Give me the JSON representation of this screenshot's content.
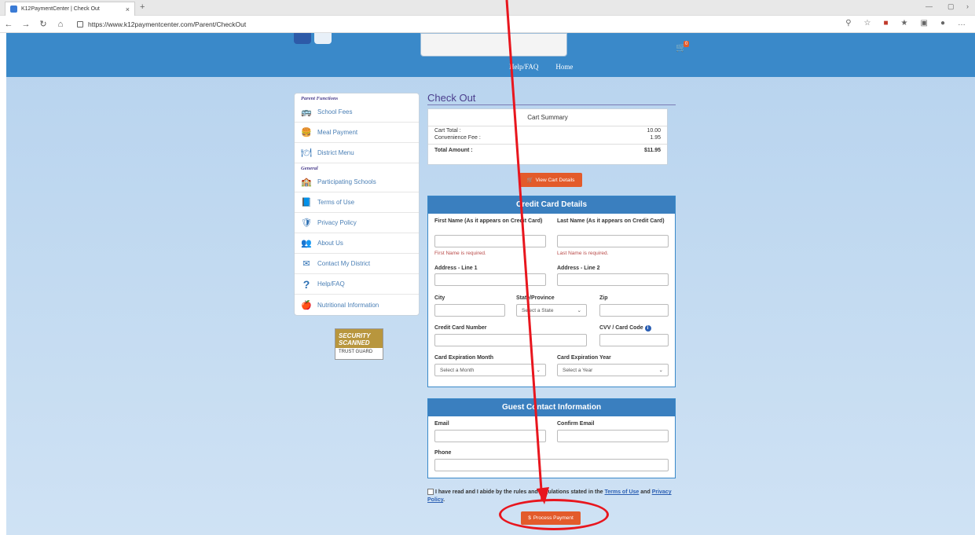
{
  "browser": {
    "tab_title": "K12PaymentCenter | Check Out",
    "tab_close": "×",
    "new_tab": "+",
    "url": "https://www.k12paymentcenter.com/Parent/CheckOut",
    "back": "←",
    "forward": "→",
    "refresh": "↻",
    "home": "⌂",
    "minimize": "—",
    "restore": "▢",
    "more": "…",
    "chevron": "›"
  },
  "header": {
    "logo_text": "",
    "cart_count": "0",
    "nav": {
      "help": "Help/FAQ",
      "home": "Home"
    }
  },
  "sidebar": {
    "sections": [
      {
        "label": "Parent Functions",
        "items": [
          {
            "label": "School Fees",
            "icon": "bus-icon"
          },
          {
            "label": "Meal Payment",
            "icon": "food-icon"
          },
          {
            "label": "District Menu",
            "icon": "plate-icon"
          }
        ]
      },
      {
        "label": "General",
        "items": [
          {
            "label": "Participating Schools",
            "icon": "school-icon"
          },
          {
            "label": "Terms of Use",
            "icon": "book-icon"
          },
          {
            "label": "Privacy Policy",
            "icon": "shield-icon"
          },
          {
            "label": "About Us",
            "icon": "people-icon"
          },
          {
            "label": "Contact My District",
            "icon": "envelope-icon"
          },
          {
            "label": "Help/FAQ",
            "icon": "question-icon"
          },
          {
            "label": "Nutritional Information",
            "icon": "apple-icon"
          }
        ]
      }
    ],
    "security_badge": {
      "title": "SECURITY SCANNED",
      "sub": "TRUST GUARD"
    }
  },
  "checkout": {
    "title": "Check Out",
    "summary": {
      "header": "Cart Summary",
      "cart_total_label": "Cart Total :",
      "cart_total_value": "10.00",
      "fee_label": "Convenience Fee :",
      "fee_value": "1.95",
      "total_label": "Total Amount :",
      "total_value": "$11.95"
    },
    "view_cart_label": "View Cart Details"
  },
  "credit_card": {
    "title": "Credit Card Details",
    "first_name_label": "First Name (As it appears on Credit Card)",
    "last_name_label": "Last Name (As it appears on Credit Card)",
    "first_name_error": "First Name is required.",
    "last_name_error": "Last Name is required.",
    "address1_label": "Address - Line 1",
    "address2_label": "Address - Line 2",
    "city_label": "City",
    "state_label": "State/Province",
    "state_placeholder": "Select a State",
    "zip_label": "Zip",
    "card_number_label": "Credit Card Number",
    "cvv_label": "CVV / Card Code",
    "exp_month_label": "Card Expiration Month",
    "exp_month_placeholder": "Select a Month",
    "exp_year_label": "Card Expiration Year",
    "exp_year_placeholder": "Select a Year"
  },
  "guest": {
    "title": "Guest Contact Information",
    "email_label": "Email",
    "confirm_email_label": "Confirm Email",
    "phone_label": "Phone"
  },
  "terms": {
    "text_before": "I have read and I abide by the rules and regulations stated in the ",
    "terms_link": "Terms of Use",
    "and": " and ",
    "privacy_link": "Privacy Policy",
    "text_after": "."
  },
  "process_label": "Process Payment",
  "colors": {
    "accent_blue": "#3a89c9",
    "button_orange": "#e35b2b",
    "annotation_red": "#e8161e"
  }
}
